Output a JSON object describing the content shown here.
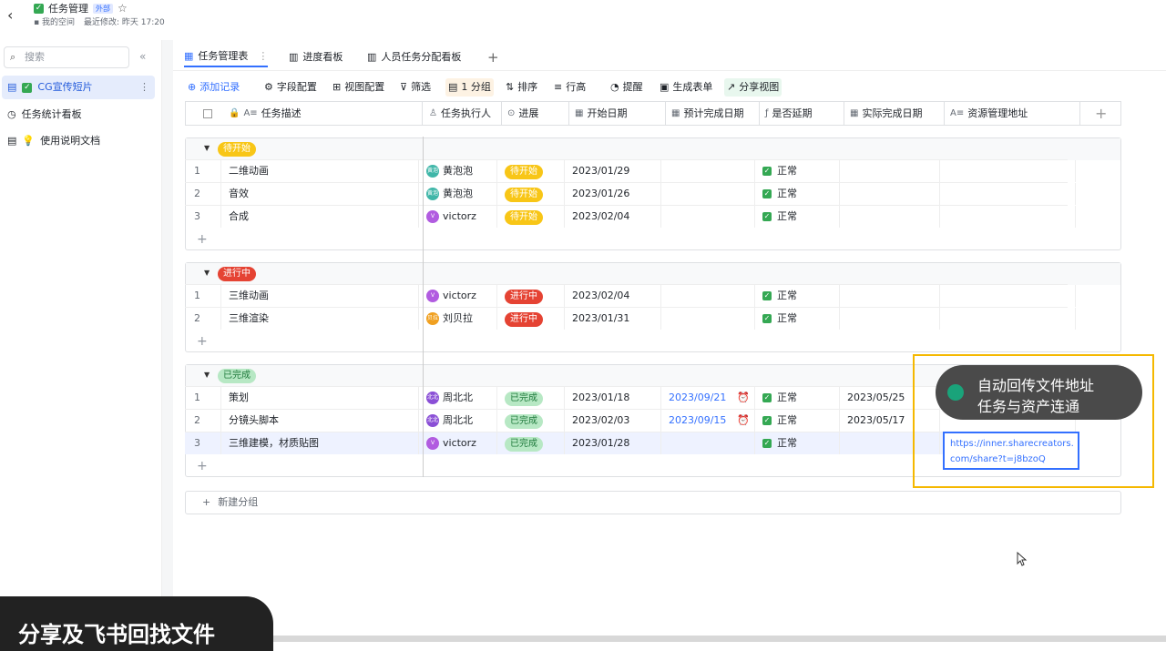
{
  "header": {
    "title": "任务管理",
    "external_tag": "外部",
    "breadcrumb": "我的空间",
    "last_modified": "最近修改: 昨天 17:20"
  },
  "sidebar": {
    "search_placeholder": "搜索",
    "items": [
      {
        "label": "CG宣传短片"
      },
      {
        "label": "任务统计看板"
      },
      {
        "label": "使用说明文档"
      }
    ]
  },
  "tabs": [
    {
      "label": "任务管理表"
    },
    {
      "label": "进度看板"
    },
    {
      "label": "人员任务分配看板"
    }
  ],
  "toolbar": {
    "add_record": "添加记录",
    "field_config": "字段配置",
    "view_config": "视图配置",
    "filter": "筛选",
    "group": "1 分组",
    "sort": "排序",
    "row_height": "行高",
    "reminder": "提醒",
    "gen_form": "生成表单",
    "share_view": "分享视图"
  },
  "columns": [
    "任务描述",
    "任务执行人",
    "进展",
    "开始日期",
    "预计完成日期",
    "是否延期",
    "实际完成日期",
    "资源管理地址"
  ],
  "groups": [
    {
      "label": "待开始",
      "rows": [
        {
          "n": "1",
          "task": "二维动画",
          "owner": "黄泡泡",
          "av": "黄泡",
          "status": "待开始",
          "start": "2023/01/29",
          "due": "",
          "delay": "正常",
          "done": ""
        },
        {
          "n": "2",
          "task": "音效",
          "owner": "黄泡泡",
          "av": "黄泡",
          "status": "待开始",
          "start": "2023/01/26",
          "due": "",
          "delay": "正常",
          "done": ""
        },
        {
          "n": "3",
          "task": "合成",
          "owner": "victorz",
          "av": "V",
          "status": "待开始",
          "start": "2023/02/04",
          "due": "",
          "delay": "正常",
          "done": ""
        }
      ]
    },
    {
      "label": "进行中",
      "rows": [
        {
          "n": "1",
          "task": "三维动画",
          "owner": "victorz",
          "av": "V",
          "status": "进行中",
          "start": "2023/02/04",
          "due": "",
          "delay": "正常",
          "done": ""
        },
        {
          "n": "2",
          "task": "三维渲染",
          "owner": "刘贝拉",
          "av": "贝拉",
          "status": "进行中",
          "start": "2023/01/31",
          "due": "",
          "delay": "正常",
          "done": ""
        }
      ]
    },
    {
      "label": "已完成",
      "rows": [
        {
          "n": "1",
          "task": "策划",
          "owner": "周北北",
          "av": "北北",
          "status": "已完成",
          "start": "2023/01/18",
          "due": "2023/09/21",
          "delay": "正常",
          "done": "2023/05/25"
        },
        {
          "n": "2",
          "task": "分镜头脚本",
          "owner": "周北北",
          "av": "北北",
          "status": "已完成",
          "start": "2023/02/03",
          "due": "2023/09/15",
          "delay": "正常",
          "done": "2023/05/17"
        },
        {
          "n": "3",
          "task": "三维建模，材质贴图",
          "owner": "victorz",
          "av": "V",
          "status": "已完成",
          "start": "2023/01/28",
          "due": "",
          "delay": "正常",
          "done": ""
        }
      ]
    }
  ],
  "new_group": "新建分组",
  "overlay": {
    "line1": "自动回传文件地址",
    "line2": "任务与资产连通",
    "url_line1": "https://inner.sharecreators.",
    "url_line2": "com/share?t=j8bzoQ"
  },
  "caption": "分享及飞书回找文件",
  "colors": {
    "accent": "#3370ff",
    "todo": "#f8c617",
    "doing": "#e54333",
    "done": "#b7e8c4",
    "highlight": "#f5b800"
  }
}
